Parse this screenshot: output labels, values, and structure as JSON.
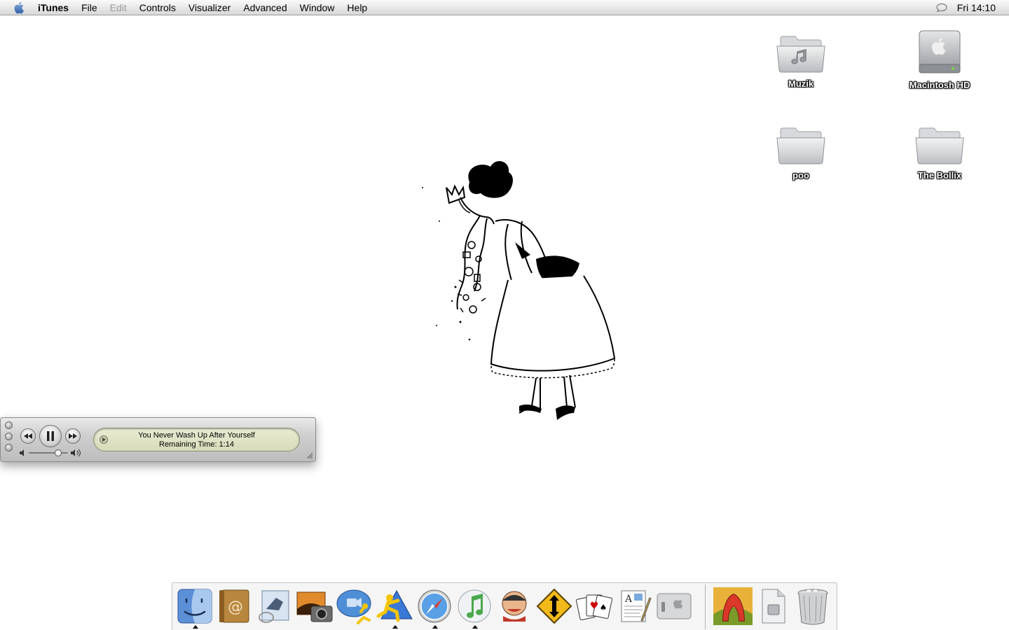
{
  "menubar": {
    "apple_icon": "apple-logo-icon",
    "app_name": "iTunes",
    "items": [
      "File",
      "Edit",
      "Controls",
      "Visualizer",
      "Advanced",
      "Window",
      "Help"
    ],
    "disabled_items": [
      "Edit"
    ],
    "clock": "Fri 14:10",
    "status_icon": "speech-bubble-icon"
  },
  "desktop": {
    "icons": [
      {
        "label": "Muzik",
        "icon": "music-folder-icon"
      },
      {
        "label": "Macintosh HD",
        "icon": "hard-drive-icon"
      },
      {
        "label": "poo",
        "icon": "folder-icon"
      },
      {
        "label": "The Bollix",
        "icon": "folder-icon"
      }
    ]
  },
  "mini_player": {
    "track_title": "You Never Wash Up After Yourself",
    "remaining": "Remaining Time: 1:14",
    "state": "playing",
    "volume_level": 0.75
  },
  "dock": {
    "apps": [
      {
        "icon": "finder-icon",
        "running": true
      },
      {
        "icon": "address-book-icon",
        "running": false
      },
      {
        "icon": "mail-icon",
        "running": false
      },
      {
        "icon": "iphoto-icon",
        "running": false
      },
      {
        "icon": "ichat-icon",
        "running": false
      },
      {
        "icon": "aim-icon",
        "running": true
      },
      {
        "icon": "safari-icon",
        "running": true
      },
      {
        "icon": "itunes-icon",
        "running": true
      },
      {
        "icon": "game-character-icon",
        "running": false
      },
      {
        "icon": "transmit-icon",
        "running": false
      },
      {
        "icon": "solitaire-icon",
        "running": false
      },
      {
        "icon": "textedit-icon",
        "running": false
      },
      {
        "icon": "system-preferences-icon",
        "running": false
      }
    ],
    "docs": [
      {
        "icon": "artwork-icon"
      },
      {
        "icon": "document-icon"
      },
      {
        "icon": "trash-icon"
      }
    ]
  },
  "colors": {
    "menubar": "#e6e6e6",
    "desktop": "#ffffff",
    "lcd": "#d9ddbb"
  }
}
